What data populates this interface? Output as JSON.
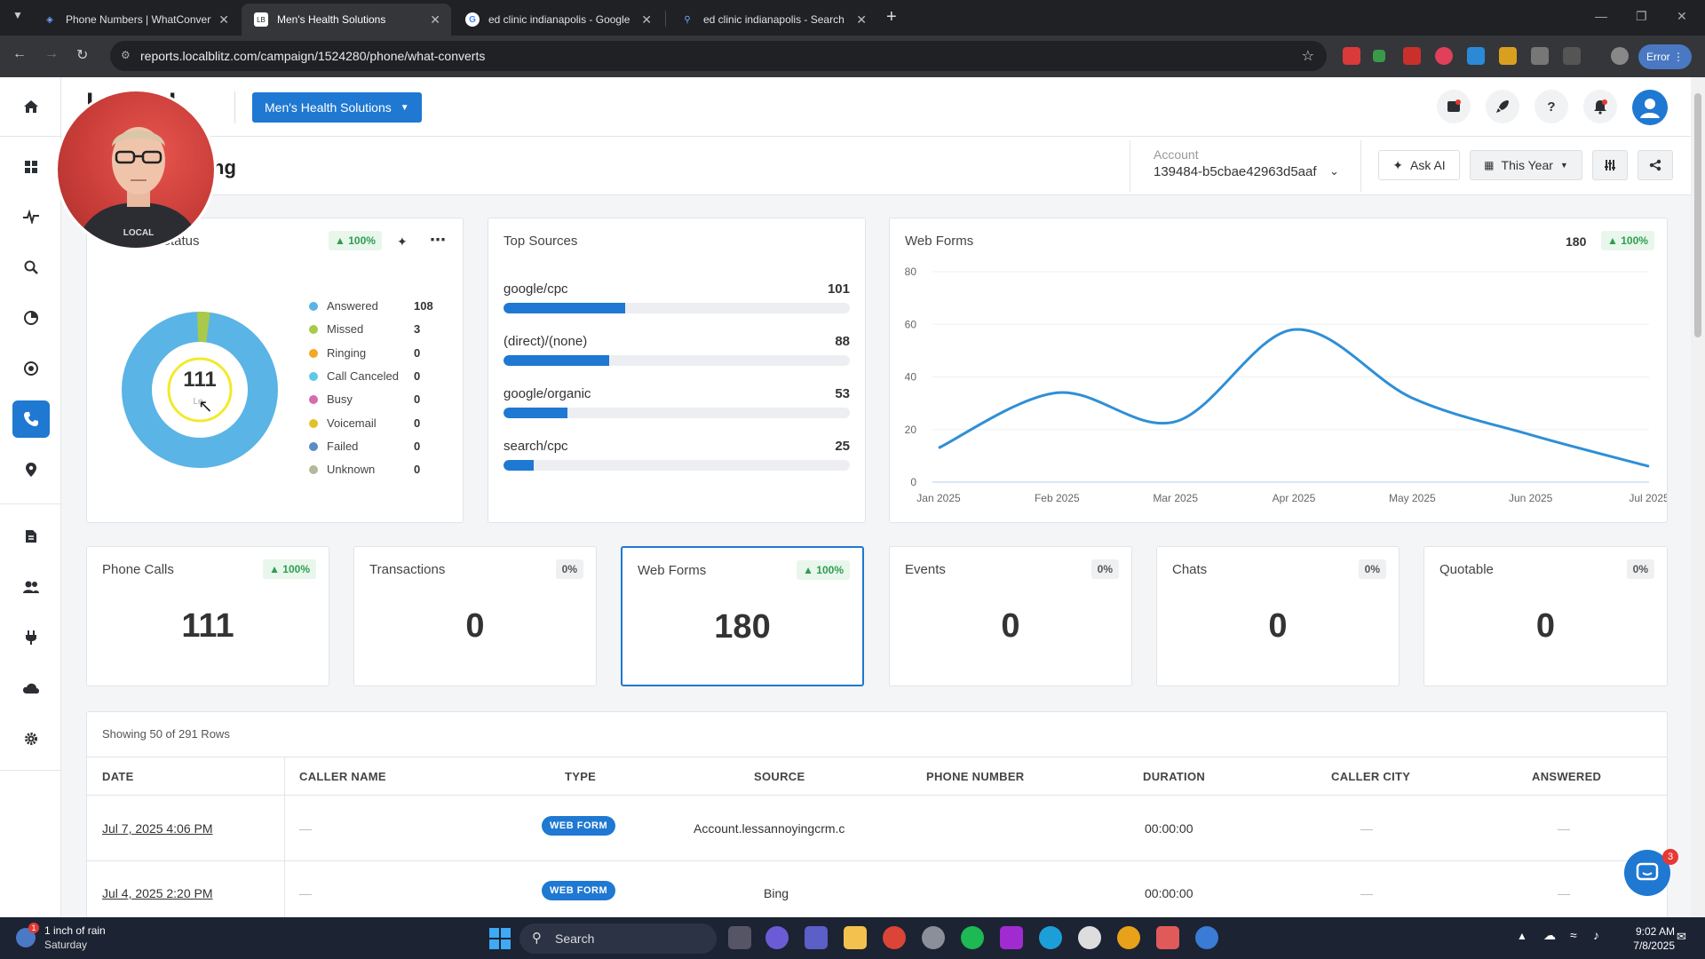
{
  "browser": {
    "tabs": [
      {
        "title": "Phone Numbers | WhatConvert",
        "icon": "whatconverts-icon"
      },
      {
        "title": "Men's Health Solutions",
        "icon": "localblitz-icon"
      },
      {
        "title": "ed clinic indianapolis - Google",
        "icon": "google-icon"
      },
      {
        "title": "ed clinic indianapolis - Search",
        "icon": "search-icon"
      }
    ],
    "url": "reports.localblitz.com/campaign/1524280/phone/what-converts",
    "error_label": "Error"
  },
  "header": {
    "logo_text": "LOCAL",
    "client_button": "Men's Health Solutions"
  },
  "subheader": {
    "page_title": "ng",
    "account_label": "Account",
    "account_value": "139484-b5cbae42963d5aaf",
    "ask_ai": "Ask AI",
    "date_range": "This Year"
  },
  "call_status": {
    "title": "Status",
    "change": "100%",
    "total": "111",
    "center_sub": "Le",
    "legend": [
      {
        "label": "Answered",
        "value": "108",
        "color": "#5ab4e5"
      },
      {
        "label": "Missed",
        "value": "3",
        "color": "#a8c94a"
      },
      {
        "label": "Ringing",
        "value": "0",
        "color": "#f5a623"
      },
      {
        "label": "Call Canceled",
        "value": "0",
        "color": "#5ec8e8"
      },
      {
        "label": "Busy",
        "value": "0",
        "color": "#d56bb0"
      },
      {
        "label": "Voicemail",
        "value": "0",
        "color": "#e2c22a"
      },
      {
        "label": "Failed",
        "value": "0",
        "color": "#5b8cc4"
      },
      {
        "label": "Unknown",
        "value": "0",
        "color": "#b5b89a"
      }
    ]
  },
  "top_sources": {
    "title": "Top Sources",
    "items": [
      {
        "name": "google/cpc",
        "value": "101",
        "fraction": 0.35
      },
      {
        "name": "(direct)/(none)",
        "value": "88",
        "fraction": 0.305
      },
      {
        "name": "google/organic",
        "value": "53",
        "fraction": 0.185
      },
      {
        "name": "search/cpc",
        "value": "25",
        "fraction": 0.087
      }
    ]
  },
  "web_forms_chart": {
    "title": "Web Forms",
    "total": "180",
    "change": "100%"
  },
  "chart_data": {
    "type": "line",
    "categories": [
      "Jan 2025",
      "Feb 2025",
      "Mar 2025",
      "Apr 2025",
      "May 2025",
      "Jun 2025",
      "Jul 2025"
    ],
    "series": [
      {
        "values": [
          13,
          34,
          23,
          58,
          32,
          18,
          6
        ],
        "color": "#2f8fd6"
      }
    ],
    "yticks": [
      "0",
      "20",
      "40",
      "60",
      "80"
    ],
    "ylim": [
      0,
      80
    ],
    "grid": true
  },
  "kpis": [
    {
      "title": "Phone Calls",
      "change": "100%",
      "value": "111",
      "positive": true
    },
    {
      "title": "Transactions",
      "change": "0%",
      "value": "0",
      "positive": false
    },
    {
      "title": "Web Forms",
      "change": "100%",
      "value": "180",
      "positive": true
    },
    {
      "title": "Events",
      "change": "0%",
      "value": "0",
      "positive": false
    },
    {
      "title": "Chats",
      "change": "0%",
      "value": "0",
      "positive": false
    },
    {
      "title": "Quotable",
      "change": "0%",
      "value": "0",
      "positive": false
    }
  ],
  "table": {
    "showing": "Showing 50 of 291 Rows",
    "columns": [
      "Date",
      "Caller Name",
      "Type",
      "Source",
      "Phone Number",
      "Duration",
      "Caller City",
      "Answered"
    ],
    "rows": [
      {
        "date": "Jul 7, 2025 4:06 PM",
        "caller_name": "—",
        "type": "WEB FORM",
        "source": "Account.lessannoyingcrm.c",
        "phone": "",
        "duration": "00:00:00",
        "city": "—",
        "answered": "—"
      },
      {
        "date": "Jul 4, 2025 2:20 PM",
        "caller_name": "—",
        "type": "WEB FORM",
        "source": "Bing",
        "phone": "",
        "duration": "00:00:00",
        "city": "—",
        "answered": "—"
      }
    ]
  },
  "chat_widget": {
    "count": "3"
  },
  "taskbar": {
    "weather_title": "1 inch of rain",
    "weather_sub": "Saturday",
    "search_placeholder": "Search",
    "time": "9:02 AM",
    "date": "7/8/2025",
    "weather_badge": "1"
  }
}
